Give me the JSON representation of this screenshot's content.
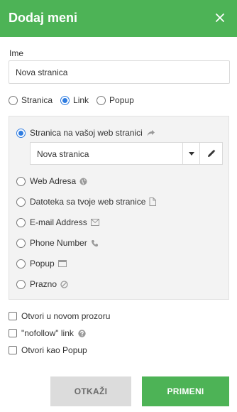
{
  "dialog": {
    "title": "Dodaj meni"
  },
  "name_field": {
    "label": "Ime",
    "value": "Nova stranica"
  },
  "type_options": [
    {
      "label": "Stranica",
      "selected": false
    },
    {
      "label": "Link",
      "selected": true
    },
    {
      "label": "Popup",
      "selected": false
    }
  ],
  "link_options": [
    {
      "label": "Stranica na vašoj web stranici",
      "icon": "share-arrow-icon",
      "selected": true
    },
    {
      "label": "Web Adresa",
      "icon": "globe-icon",
      "selected": false
    },
    {
      "label": "Datoteka sa tvoje web stranice",
      "icon": "file-icon",
      "selected": false
    },
    {
      "label": "E-mail Address",
      "icon": "envelope-icon",
      "selected": false
    },
    {
      "label": "Phone Number",
      "icon": "phone-icon",
      "selected": false
    },
    {
      "label": "Popup",
      "icon": "window-icon",
      "selected": false
    },
    {
      "label": "Prazno",
      "icon": "ban-icon",
      "selected": false
    }
  ],
  "page_select": {
    "value": "Nova stranica"
  },
  "checkboxes": [
    {
      "label": "Otvori u novom prozoru",
      "checked": false
    },
    {
      "label": "\"nofollow\" link",
      "checked": false
    },
    {
      "label": "Otvori kao Popup",
      "checked": false
    }
  ],
  "buttons": {
    "cancel": "OTKAŽI",
    "apply": "PRIMENI"
  },
  "colors": {
    "header": "#4db356",
    "accent": "#2f7ce0",
    "cancel_bg": "#dcdcdc"
  }
}
